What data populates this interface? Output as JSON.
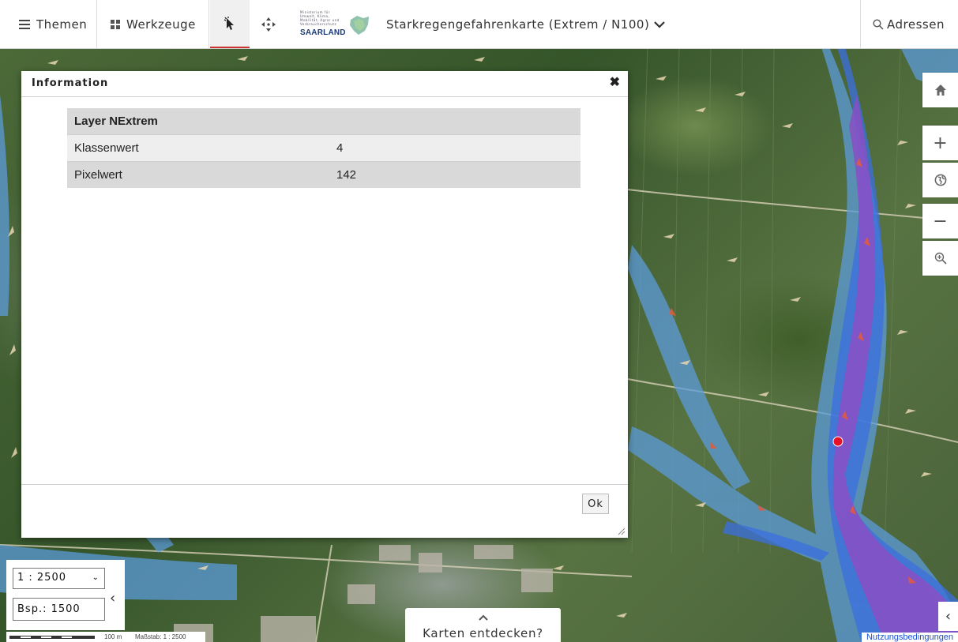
{
  "toolbar": {
    "themen_label": "Themen",
    "werkzeuge_label": "Werkzeuge",
    "logo_small_text": "Ministerium für Umwelt, Klima, Mobilität, Agrar und Verbraucherschutz",
    "logo_word": "SAARLAND",
    "map_title": "Starkregengefahrenkarte (Extrem / N100)",
    "adressen_label": "Adressen"
  },
  "dialog": {
    "title": "Information",
    "table_header": "Layer NExtrem",
    "rows": [
      {
        "key": "Klassenwert",
        "value": "4"
      },
      {
        "key": "Pixelwert",
        "value": "142"
      }
    ],
    "ok_label": "Ok"
  },
  "scale": {
    "selected": "1 : 2500",
    "example_input": "Bsp.: 1500"
  },
  "scalebar": {
    "distance_label": "100 m",
    "scale_text": "Maßstab: 1 : 2500"
  },
  "discover_label": "Karten entdecken?",
  "terms_link": "Nutzungsbedingungen",
  "colors": {
    "flood_light": "#5b9bd9",
    "flood_medium": "#3b6fe0",
    "flood_extreme": "#8a4fc4",
    "active_tool_underline": "#cc3333"
  },
  "icons": [
    "menu-icon",
    "grid-icon",
    "pointer-info-icon",
    "pan-icon",
    "search-icon",
    "home-icon",
    "zoom-in-icon",
    "globe-icon",
    "zoom-out-icon",
    "zoom-box-icon",
    "close-icon",
    "chevron-left-icon",
    "chevron-up-icon"
  ]
}
